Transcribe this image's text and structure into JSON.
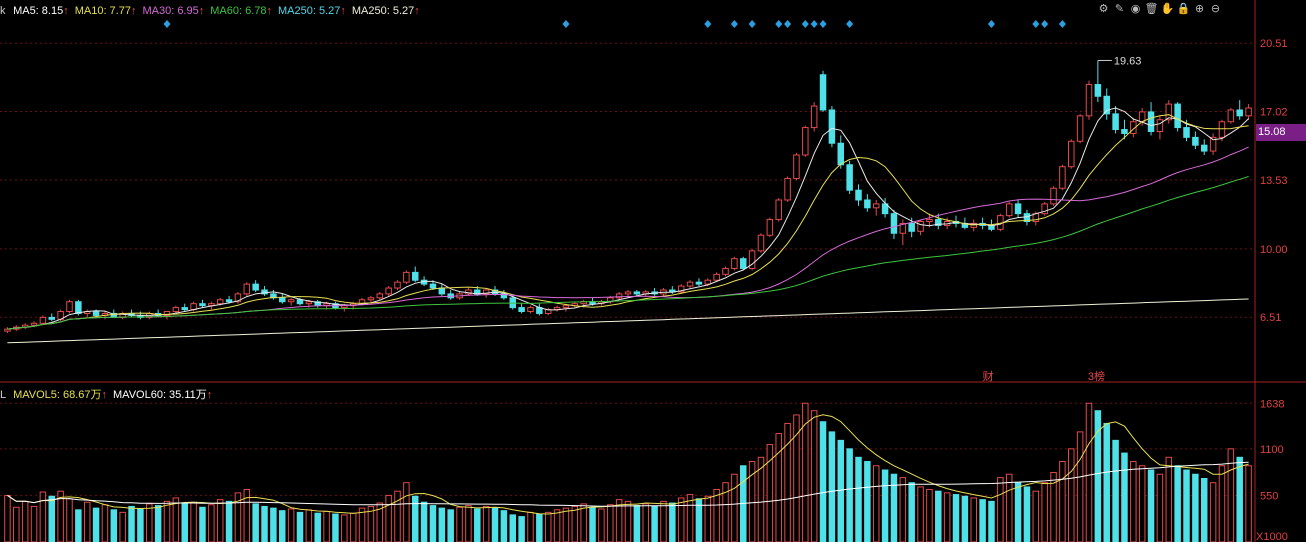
{
  "colors": {
    "up": "#e34a4a",
    "down": "#4fe0e8",
    "ma5": "#e8e8e8",
    "ma10": "#e8e050",
    "ma30": "#d86ad8",
    "ma60": "#3cc43c",
    "ma250": "#f0f0d8",
    "grid": "#6a1010",
    "axis": "#a52020",
    "marker": "#2ba0e0",
    "badge": "#7a1f86"
  },
  "ma_legend": {
    "prefix": "k",
    "items": [
      {
        "label": "MA5: 8.15",
        "arrow": "↑",
        "color": "#ffffff"
      },
      {
        "label": "MA10: 7.77",
        "arrow": "↑",
        "color": "#e8e050"
      },
      {
        "label": "MA30: 6.95",
        "arrow": "↑",
        "color": "#d86ad8"
      },
      {
        "label": "MA60: 6.78",
        "arrow": "↑",
        "color": "#3cc43c"
      },
      {
        "label": "MA250: 5.27",
        "arrow": "↑",
        "color": "#4fd8e8"
      },
      {
        "label": "MA250: 5.27",
        "arrow": "↑",
        "color": "#f0f0d8"
      }
    ]
  },
  "vol_legend": {
    "prefix": "L",
    "items": [
      {
        "label": "MAVOL5: 68.67万",
        "arrow": "↑",
        "color": "#e8e050"
      },
      {
        "label": "MAVOL60: 35.11万",
        "arrow": "↑",
        "color": "#ffffff"
      }
    ]
  },
  "toolbar": [
    {
      "name": "settings-icon",
      "glyph": "⚙"
    },
    {
      "name": "draw-icon",
      "glyph": "✎"
    },
    {
      "name": "eye-icon",
      "glyph": "◉"
    },
    {
      "name": "trash-icon",
      "glyph": "🗑"
    },
    {
      "name": "hand-icon",
      "glyph": "✋"
    },
    {
      "name": "lock-icon",
      "glyph": "🔒"
    },
    {
      "name": "zoom-in-icon",
      "glyph": "⊕"
    },
    {
      "name": "zoom-out-icon",
      "glyph": "⊖"
    }
  ],
  "current_price": "15.08",
  "chart_data": [
    {
      "type": "candlestick",
      "y_ticks": [
        "20.51",
        "17.02",
        "13.53",
        "10.00",
        "6.51"
      ],
      "ylim": [
        3.3,
        21.8
      ],
      "high_annotation": "19.63",
      "event_labels": [
        "财",
        "3榜"
      ],
      "candles": [
        [
          5.8,
          6.0,
          5.7,
          5.9
        ],
        [
          5.9,
          6.1,
          5.8,
          6.0
        ],
        [
          6.0,
          6.2,
          5.9,
          6.1
        ],
        [
          6.1,
          6.3,
          6.0,
          6.2
        ],
        [
          6.2,
          6.6,
          6.1,
          6.5
        ],
        [
          6.5,
          6.7,
          6.3,
          6.4
        ],
        [
          6.4,
          6.9,
          6.3,
          6.8
        ],
        [
          6.8,
          7.4,
          6.7,
          7.3
        ],
        [
          7.3,
          7.4,
          6.6,
          6.7
        ],
        [
          6.7,
          6.9,
          6.5,
          6.8
        ],
        [
          6.8,
          6.9,
          6.5,
          6.6
        ],
        [
          6.6,
          6.8,
          6.4,
          6.7
        ],
        [
          6.7,
          6.9,
          6.5,
          6.5
        ],
        [
          6.5,
          6.8,
          6.4,
          6.7
        ],
        [
          6.7,
          6.9,
          6.5,
          6.6
        ],
        [
          6.6,
          6.8,
          6.4,
          6.5
        ],
        [
          6.5,
          6.8,
          6.4,
          6.7
        ],
        [
          6.7,
          6.9,
          6.5,
          6.6
        ],
        [
          6.6,
          6.8,
          6.4,
          6.8
        ],
        [
          6.8,
          7.1,
          6.7,
          7.0
        ],
        [
          7.0,
          7.2,
          6.8,
          6.9
        ],
        [
          6.9,
          7.3,
          6.8,
          7.2
        ],
        [
          7.2,
          7.4,
          7.0,
          7.1
        ],
        [
          7.1,
          7.3,
          6.9,
          7.2
        ],
        [
          7.2,
          7.5,
          7.1,
          7.4
        ],
        [
          7.4,
          7.6,
          7.2,
          7.3
        ],
        [
          7.3,
          7.8,
          7.2,
          7.7
        ],
        [
          7.7,
          8.3,
          7.6,
          8.2
        ],
        [
          8.2,
          8.4,
          7.8,
          7.9
        ],
        [
          7.9,
          8.1,
          7.6,
          7.7
        ],
        [
          7.7,
          7.9,
          7.4,
          7.5
        ],
        [
          7.5,
          7.7,
          7.2,
          7.3
        ],
        [
          7.3,
          7.5,
          7.1,
          7.4
        ],
        [
          7.4,
          7.5,
          7.1,
          7.2
        ],
        [
          7.2,
          7.4,
          7.0,
          7.3
        ],
        [
          7.3,
          7.4,
          7.0,
          7.1
        ],
        [
          7.1,
          7.3,
          6.9,
          7.2
        ],
        [
          7.2,
          7.3,
          6.9,
          7.0
        ],
        [
          7.0,
          7.2,
          6.8,
          7.1
        ],
        [
          7.1,
          7.3,
          6.9,
          7.2
        ],
        [
          7.2,
          7.5,
          7.1,
          7.4
        ],
        [
          7.4,
          7.6,
          7.2,
          7.5
        ],
        [
          7.5,
          7.8,
          7.4,
          7.7
        ],
        [
          7.7,
          8.1,
          7.6,
          8.0
        ],
        [
          8.0,
          8.4,
          7.9,
          8.3
        ],
        [
          8.3,
          8.9,
          8.2,
          8.8
        ],
        [
          8.8,
          9.1,
          8.3,
          8.4
        ],
        [
          8.4,
          8.6,
          8.1,
          8.2
        ],
        [
          8.2,
          8.4,
          7.9,
          8.0
        ],
        [
          8.0,
          8.2,
          7.6,
          7.7
        ],
        [
          7.7,
          7.9,
          7.4,
          7.5
        ],
        [
          7.5,
          7.8,
          7.4,
          7.7
        ],
        [
          7.7,
          8.0,
          7.6,
          7.9
        ],
        [
          7.9,
          8.1,
          7.6,
          7.7
        ],
        [
          7.7,
          8.0,
          7.5,
          7.9
        ],
        [
          7.9,
          8.1,
          7.6,
          7.7
        ],
        [
          7.7,
          7.9,
          7.4,
          7.5
        ],
        [
          7.5,
          7.6,
          6.9,
          7.0
        ],
        [
          7.0,
          7.2,
          6.7,
          6.8
        ],
        [
          6.8,
          7.1,
          6.7,
          7.0
        ],
        [
          7.0,
          7.2,
          6.6,
          6.7
        ],
        [
          6.7,
          7.0,
          6.6,
          6.9
        ],
        [
          6.9,
          7.1,
          6.8,
          7.0
        ],
        [
          7.0,
          7.2,
          6.8,
          7.1
        ],
        [
          7.1,
          7.3,
          7.0,
          7.2
        ],
        [
          7.2,
          7.4,
          7.0,
          7.3
        ],
        [
          7.3,
          7.5,
          7.1,
          7.2
        ],
        [
          7.2,
          7.4,
          7.1,
          7.3
        ],
        [
          7.3,
          7.6,
          7.2,
          7.5
        ],
        [
          7.5,
          7.8,
          7.4,
          7.7
        ],
        [
          7.7,
          7.9,
          7.5,
          7.8
        ],
        [
          7.8,
          7.9,
          7.6,
          7.7
        ],
        [
          7.7,
          7.9,
          7.6,
          7.8
        ],
        [
          7.8,
          8.0,
          7.6,
          7.7
        ],
        [
          7.7,
          8.0,
          7.6,
          7.9
        ],
        [
          7.9,
          8.1,
          7.7,
          7.8
        ],
        [
          7.8,
          8.2,
          7.7,
          8.1
        ],
        [
          8.1,
          8.4,
          8.0,
          8.3
        ],
        [
          8.3,
          8.5,
          8.1,
          8.2
        ],
        [
          8.2,
          8.5,
          8.1,
          8.4
        ],
        [
          8.4,
          8.8,
          8.3,
          8.7
        ],
        [
          8.7,
          9.1,
          8.6,
          9.0
        ],
        [
          9.0,
          9.6,
          8.9,
          9.5
        ],
        [
          9.5,
          9.6,
          8.9,
          9.0
        ],
        [
          9.0,
          10.0,
          8.9,
          9.9
        ],
        [
          9.9,
          10.8,
          9.8,
          10.7
        ],
        [
          10.7,
          11.6,
          10.6,
          11.5
        ],
        [
          11.5,
          12.6,
          11.4,
          12.5
        ],
        [
          12.5,
          13.7,
          12.4,
          13.6
        ],
        [
          13.6,
          14.9,
          13.5,
          14.8
        ],
        [
          14.8,
          16.3,
          14.7,
          16.2
        ],
        [
          16.2,
          17.5,
          16.0,
          17.3
        ],
        [
          18.9,
          19.1,
          17.0,
          17.1
        ],
        [
          17.1,
          17.3,
          15.2,
          15.4
        ],
        [
          15.4,
          15.8,
          14.1,
          14.3
        ],
        [
          14.3,
          14.5,
          12.8,
          13.0
        ],
        [
          13.0,
          13.3,
          12.2,
          12.5
        ],
        [
          12.5,
          12.8,
          11.9,
          12.1
        ],
        [
          12.1,
          12.5,
          11.7,
          12.3
        ],
        [
          12.3,
          12.6,
          11.6,
          11.8
        ],
        [
          11.8,
          12.0,
          10.5,
          10.8
        ],
        [
          10.8,
          11.5,
          10.2,
          11.3
        ],
        [
          11.3,
          11.6,
          10.6,
          10.9
        ],
        [
          10.9,
          11.5,
          10.7,
          11.4
        ],
        [
          11.4,
          11.8,
          11.1,
          11.5
        ],
        [
          11.5,
          11.8,
          11.0,
          11.2
        ],
        [
          11.2,
          11.6,
          11.0,
          11.4
        ],
        [
          11.4,
          11.7,
          11.1,
          11.3
        ],
        [
          11.3,
          11.6,
          11.0,
          11.1
        ],
        [
          11.1,
          11.5,
          10.9,
          11.3
        ],
        [
          11.3,
          11.6,
          11.0,
          11.2
        ],
        [
          11.2,
          11.5,
          10.9,
          11.0
        ],
        [
          11.0,
          11.8,
          10.9,
          11.7
        ],
        [
          11.7,
          12.4,
          11.6,
          12.3
        ],
        [
          12.3,
          12.5,
          11.6,
          11.8
        ],
        [
          11.8,
          12.0,
          11.2,
          11.4
        ],
        [
          11.4,
          11.9,
          11.2,
          11.8
        ],
        [
          11.8,
          12.4,
          11.7,
          12.3
        ],
        [
          12.3,
          13.2,
          12.2,
          13.1
        ],
        [
          13.1,
          14.3,
          13.0,
          14.2
        ],
        [
          14.2,
          15.6,
          14.1,
          15.5
        ],
        [
          15.5,
          16.9,
          15.4,
          16.8
        ],
        [
          16.8,
          18.6,
          16.6,
          18.4
        ],
        [
          18.4,
          19.63,
          17.5,
          17.8
        ],
        [
          17.8,
          18.2,
          16.6,
          16.9
        ],
        [
          16.9,
          17.3,
          15.9,
          16.1
        ],
        [
          16.1,
          16.6,
          15.6,
          15.9
        ],
        [
          15.9,
          16.7,
          15.7,
          16.5
        ],
        [
          16.5,
          17.2,
          16.3,
          17.0
        ],
        [
          17.0,
          17.5,
          15.8,
          16.0
        ],
        [
          16.0,
          16.8,
          15.6,
          16.6
        ],
        [
          16.6,
          17.6,
          16.4,
          17.4
        ],
        [
          17.4,
          17.5,
          16.0,
          16.2
        ],
        [
          16.2,
          16.6,
          15.5,
          15.7
        ],
        [
          15.7,
          16.0,
          15.1,
          15.3
        ],
        [
          15.3,
          15.6,
          14.8,
          15.0
        ],
        [
          15.0,
          15.9,
          14.8,
          15.7
        ],
        [
          15.7,
          16.6,
          15.5,
          16.5
        ],
        [
          16.5,
          17.2,
          16.4,
          17.1
        ],
        [
          17.1,
          17.6,
          16.6,
          16.8
        ],
        [
          16.8,
          17.4,
          16.6,
          17.2
        ]
      ],
      "volume": {
        "y_ticks": [
          "1638",
          "1100",
          "550",
          "X1000"
        ],
        "ylim": [
          0,
          1700
        ],
        "values": [
          550,
          410,
          480,
          420,
          590,
          540,
          600,
          510,
          380,
          470,
          400,
          440,
          380,
          350,
          420,
          390,
          450,
          430,
          480,
          520,
          450,
          470,
          410,
          440,
          500,
          480,
          580,
          620,
          450,
          420,
          400,
          370,
          390,
          350,
          380,
          340,
          360,
          330,
          320,
          340,
          400,
          420,
          460,
          550,
          600,
          700,
          540,
          470,
          430,
          400,
          380,
          410,
          430,
          390,
          420,
          400,
          370,
          320,
          300,
          350,
          330,
          350,
          380,
          400,
          420,
          450,
          410,
          390,
          440,
          500,
          480,
          430,
          450,
          420,
          480,
          460,
          520,
          560,
          510,
          540,
          620,
          700,
          800,
          900,
          950,
          1000,
          1150,
          1280,
          1400,
          1500,
          1638,
          1550,
          1420,
          1300,
          1200,
          1100,
          1000,
          950,
          900,
          850,
          800,
          760,
          700,
          650,
          620,
          600,
          580,
          560,
          540,
          520,
          500,
          480,
          760,
          800,
          700,
          650,
          600,
          700,
          820,
          950,
          1100,
          1300,
          1638,
          1550,
          1400,
          1200,
          1050,
          950,
          900,
          850,
          800,
          1000,
          900,
          850,
          800,
          750,
          700,
          900,
          1100,
          1000,
          900,
          800,
          750
        ]
      }
    }
  ]
}
